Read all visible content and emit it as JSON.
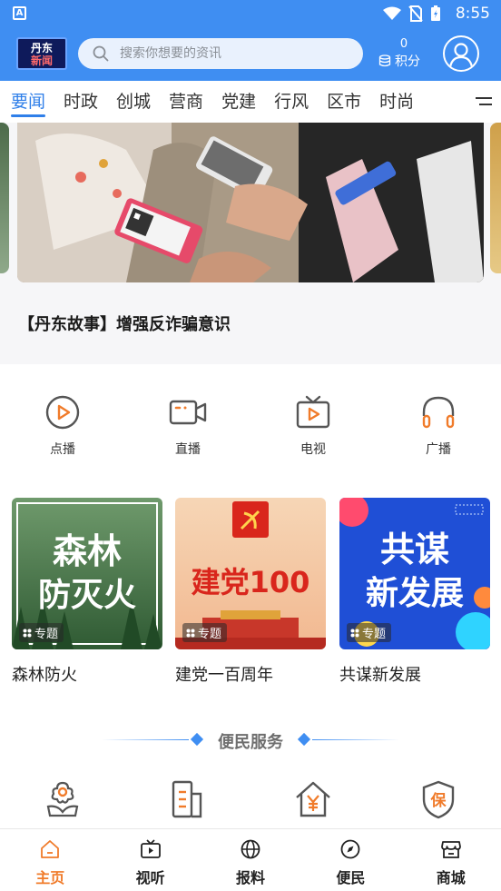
{
  "status_bar": {
    "time": "8:55",
    "app_indicator": "A",
    "icons": [
      "wifi-icon",
      "no-sim-icon",
      "battery-charging-icon"
    ]
  },
  "header": {
    "logo_line1": "丹东",
    "logo_line2": "新闻",
    "search_placeholder": "搜索你想要的资讯",
    "points_value": "0",
    "points_label": "积分",
    "brand_color": "#3f8ef2"
  },
  "tabs": {
    "items": [
      "要闻",
      "时政",
      "创城",
      "营商",
      "党建",
      "行风",
      "区市",
      "时尚"
    ],
    "active_index": 0,
    "active_color": "#2f7fe9"
  },
  "banner": {
    "title": "【丹东故事】增强反诈骗意识"
  },
  "quick_entries": [
    {
      "label": "点播",
      "icon": "play-circle-icon"
    },
    {
      "label": "直播",
      "icon": "video-camera-icon"
    },
    {
      "label": "电视",
      "icon": "tv-icon"
    },
    {
      "label": "广播",
      "icon": "headphones-icon"
    }
  ],
  "topics": [
    {
      "name": "森林防火",
      "tag": "专题",
      "art_line1": "森林",
      "art_line2": "防灭火"
    },
    {
      "name": "建党一百周年",
      "tag": "专题",
      "art_line1": "建党100",
      "art_line2": ""
    },
    {
      "name": "共谋新发展",
      "tag": "专题",
      "art_line1": "共谋",
      "art_line2": "新发展"
    }
  ],
  "services": {
    "title": "便民服务",
    "items": [
      {
        "icon": "flower-icon"
      },
      {
        "icon": "document-building-icon"
      },
      {
        "icon": "house-yuan-icon"
      },
      {
        "icon": "shield-insurance-icon"
      }
    ]
  },
  "bottom_nav": {
    "items": [
      {
        "label": "主页",
        "icon": "home-icon"
      },
      {
        "label": "视听",
        "icon": "tv-play-icon"
      },
      {
        "label": "报料",
        "icon": "globe-icon"
      },
      {
        "label": "便民",
        "icon": "compass-icon"
      },
      {
        "label": "商城",
        "icon": "store-icon"
      }
    ],
    "active_index": 0,
    "active_color": "#f07b2a"
  }
}
